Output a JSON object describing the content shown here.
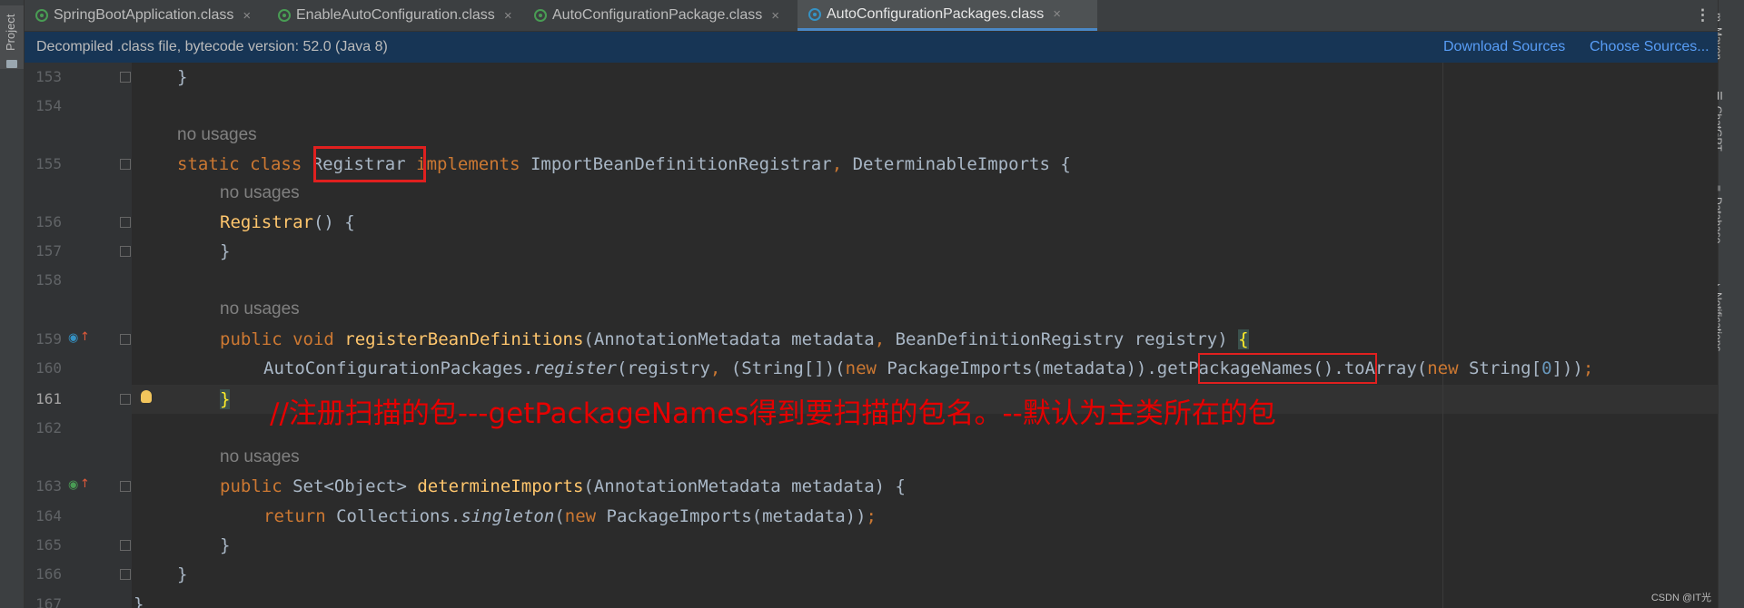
{
  "left_toolwindow": {
    "label": "Project"
  },
  "right_toolwindows": [
    {
      "label": "Maven",
      "icon": "maven-icon"
    },
    {
      "label": "ChatGPT",
      "icon": "chatgpt-icon"
    },
    {
      "label": "Database",
      "icon": "database-icon"
    },
    {
      "label": "Notifications",
      "icon": "bell-icon"
    }
  ],
  "tabs": [
    {
      "label": "SpringBootApplication.class",
      "active": false
    },
    {
      "label": "EnableAutoConfiguration.class",
      "active": false
    },
    {
      "label": "AutoConfigurationPackage.class",
      "active": false
    },
    {
      "label": "AutoConfigurationPackages.class",
      "active": true
    }
  ],
  "banner": {
    "message": "Decompiled .class file, bytecode version: 52.0 (Java 8)",
    "download_sources": "Download Sources",
    "choose_sources": "Choose Sources..."
  },
  "editor": {
    "current_line": "161",
    "usage_hint": "no usages",
    "lines": [
      {
        "num": "153",
        "code": "    }"
      },
      {
        "num": "154",
        "code": ""
      },
      {
        "num": "155",
        "code": "    static class Registrar implements ImportBeanDefinitionRegistrar, DeterminableImports {"
      },
      {
        "num": "156",
        "code": "        Registrar() {"
      },
      {
        "num": "157",
        "code": "        }"
      },
      {
        "num": "158",
        "code": ""
      },
      {
        "num": "159",
        "code": "        public void registerBeanDefinitions(AnnotationMetadata metadata, BeanDefinitionRegistry registry) {"
      },
      {
        "num": "160",
        "code": "            AutoConfigurationPackages.register(registry, (String[])(new PackageImports(metadata)).getPackageNames().toArray(new String[0]));"
      },
      {
        "num": "161",
        "code": "        }"
      },
      {
        "num": "162",
        "code": ""
      },
      {
        "num": "163",
        "code": "        public Set<Object> determineImports(AnnotationMetadata metadata) {"
      },
      {
        "num": "164",
        "code": "            return Collections.singleton(new PackageImports(metadata));"
      },
      {
        "num": "165",
        "code": "        }"
      },
      {
        "num": "166",
        "code": "    }"
      },
      {
        "num": "167",
        "code": "}"
      }
    ],
    "annotation": "//注册扫描的包---getPackageNames得到要扫描的包名。--默认为主类所在的包"
  },
  "watermark": "CSDN @IT光",
  "colors": {
    "annotation_red": "#e60000",
    "keyword": "#cc7832",
    "method": "#ffc66d",
    "link": "#589df6"
  }
}
